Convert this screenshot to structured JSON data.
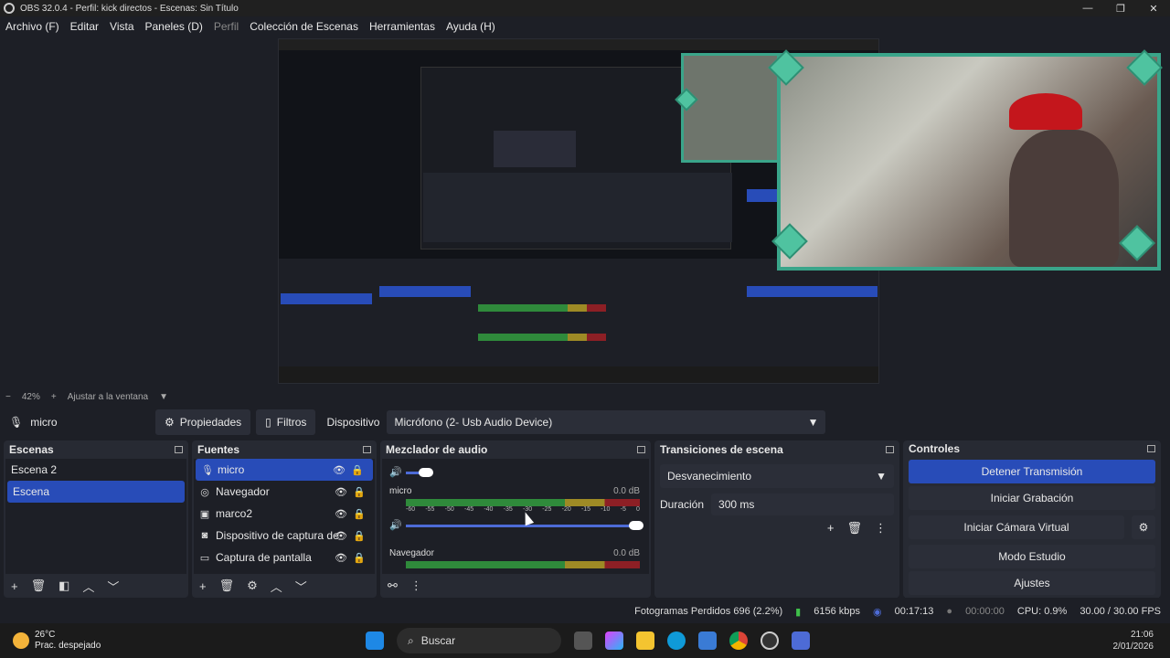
{
  "window": {
    "title": "OBS 32.0.4 - Perfil: kick directos - Escenas: Sin Título",
    "min": "—",
    "max": "❐",
    "close": "✕"
  },
  "menu": [
    "Archivo (F)",
    "Editar",
    "Vista",
    "Paneles (D)",
    "Perfil",
    "Colección de Escenas",
    "Herramientas",
    "Ayuda (H)"
  ],
  "zoom": {
    "minus": "−",
    "value": "42%",
    "plus": "+",
    "fit": "Ajustar a la ventana"
  },
  "source_toolbar": {
    "name": "micro",
    "properties": "Propiedades",
    "filters": "Filtros",
    "device_label": "Dispositivo",
    "device_value": "Micrófono (2- Usb Audio Device)"
  },
  "scenes": {
    "title": "Escenas",
    "items": [
      "Escena 2",
      "Escena"
    ],
    "active": "Escena"
  },
  "sources": {
    "title": "Fuentes",
    "items": [
      {
        "icon": "mic-icon",
        "label": "micro"
      },
      {
        "icon": "browser-icon",
        "label": "Navegador"
      },
      {
        "icon": "image-icon",
        "label": "marco2"
      },
      {
        "icon": "camera-icon",
        "label": "Dispositivo de captura de"
      },
      {
        "icon": "monitor-icon",
        "label": "Captura de pantalla"
      }
    ]
  },
  "mixer": {
    "title": "Mezclador de audio",
    "channels": [
      {
        "name": "micro",
        "db": "0.0 dB"
      },
      {
        "name": "Navegador",
        "db": "0.0 dB"
      }
    ],
    "ticks": [
      "-60",
      "-55",
      "-50",
      "-45",
      "-40",
      "-35",
      "-30",
      "-25",
      "-20",
      "-15",
      "-10",
      "-5",
      "0"
    ]
  },
  "transitions": {
    "title": "Transiciones de escena",
    "selected": "Desvanecimiento",
    "duration_label": "Duración",
    "duration_value": "300 ms"
  },
  "controls": {
    "title": "Controles",
    "buttons": [
      "Detener Transmisión",
      "Iniciar Grabación",
      "Iniciar Cámara Virtual",
      "Modo Estudio",
      "Ajustes"
    ]
  },
  "status": {
    "dropped": "Fotogramas Perdidos 696 (2.2%)",
    "bitrate": "6156 kbps",
    "stream_time": "00:17:13",
    "rec_time": "00:00:00",
    "cpu": "CPU: 0.9%",
    "fps": "30.00 / 30.00 FPS"
  },
  "taskbar": {
    "temp": "26°C",
    "weather": "Prac. despejado",
    "search": "Buscar",
    "time": "21:06",
    "date": "2/01/2026"
  }
}
